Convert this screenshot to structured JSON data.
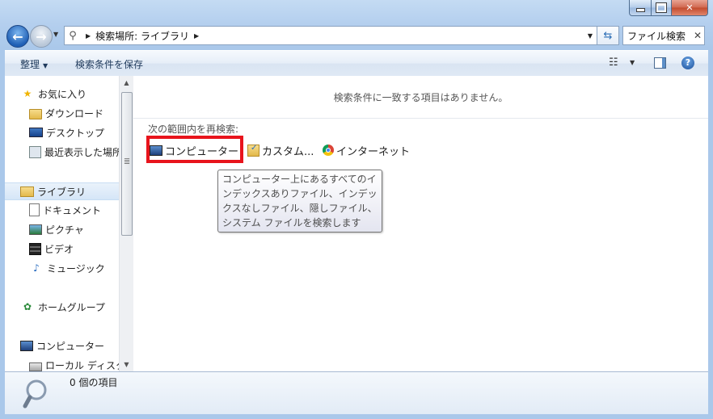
{
  "address": {
    "crumb": "検索場所: ライブラリ"
  },
  "search": {
    "value": "ファイル検索"
  },
  "toolbar": {
    "organize": "整理",
    "save_search": "検索条件を保存"
  },
  "nav": {
    "favorites": "お気に入り",
    "downloads": "ダウンロード",
    "desktop": "デスクトップ",
    "recent": "最近表示した場所",
    "libraries": "ライブラリ",
    "documents": "ドキュメント",
    "pictures": "ピクチャ",
    "videos": "ビデオ",
    "music": "ミュージック",
    "homegroup": "ホームグループ",
    "computer": "コンピューター",
    "local_disk": "ローカル ディスク"
  },
  "content": {
    "no_match": "検索条件に一致する項目はありません。",
    "search_again": "次の範囲内を再検索:",
    "options": {
      "computer": "コンピューター",
      "custom": "カスタム...",
      "internet": "インターネット"
    },
    "tooltip": "コンピューター上にあるすべてのインデックスありファイル、インデックスなしファイル、隠しファイル、システム ファイルを検索します"
  },
  "details": {
    "count": "0 個の項目"
  },
  "colors": {
    "highlight_border": "#e8141c",
    "window_frame": "#aac8ea",
    "accent": "#1e395b"
  }
}
